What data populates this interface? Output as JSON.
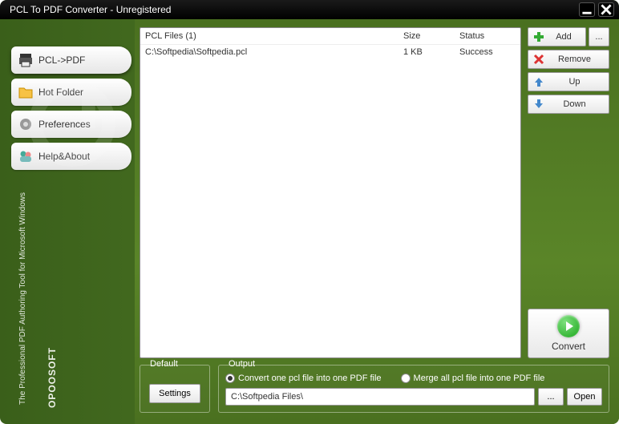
{
  "title": "PCL To PDF Converter - Unregistered",
  "sidebar": {
    "items": [
      {
        "label": "PCL->PDF",
        "icon": "printer-icon"
      },
      {
        "label": "Hot Folder",
        "icon": "folder-icon"
      },
      {
        "label": "Preferences",
        "icon": "gear-icon"
      },
      {
        "label": "Help&About",
        "icon": "people-icon"
      }
    ]
  },
  "tagline": "The Professional PDF Authoring Tool for Microsoft Windows",
  "brand": "OPOOSOFT",
  "filelist": {
    "header_name": "PCL Files (1)",
    "header_size": "Size",
    "header_status": "Status",
    "rows": [
      {
        "name": "C:\\Softpedia\\Softpedia.pcl",
        "size": "1 KB",
        "status": "Success"
      }
    ]
  },
  "buttons": {
    "add": "Add",
    "browse": "...",
    "remove": "Remove",
    "up": "Up",
    "down": "Down",
    "convert": "Convert"
  },
  "default_group": {
    "legend": "Default",
    "settings": "Settings"
  },
  "output_group": {
    "legend": "Output",
    "option_one": "Convert one pcl file into one PDF file",
    "option_merge": "Merge all pcl file into one PDF file",
    "selected": "one",
    "path": "C:\\Softpedia Files\\",
    "browse": "...",
    "open": "Open"
  }
}
